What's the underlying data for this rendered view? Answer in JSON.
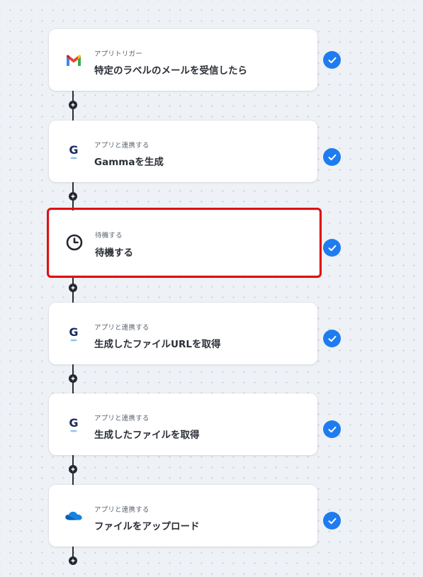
{
  "steps": [
    {
      "kind": "アプリトリガー",
      "title": "特定のラベルのメールを受信したら",
      "icon": "gmail-icon",
      "status": "complete"
    },
    {
      "kind": "アプリと連携する",
      "title": "Gammaを生成",
      "icon": "gamma-icon",
      "status": "complete"
    },
    {
      "kind": "待機する",
      "title": "待機する",
      "icon": "clock-icon",
      "status": "complete",
      "selected": true
    },
    {
      "kind": "アプリと連携する",
      "title": "生成したファイルURLを取得",
      "icon": "gamma-icon",
      "status": "complete"
    },
    {
      "kind": "アプリと連携する",
      "title": "生成したファイルを取得",
      "icon": "gamma-icon",
      "status": "complete"
    },
    {
      "kind": "アプリと連携する",
      "title": "ファイルをアップロード",
      "icon": "onedrive-icon",
      "status": "complete"
    }
  ],
  "colors": {
    "check": "#1f7cf0",
    "selected_outline": "#e01111",
    "connector": "#2b2f36",
    "gmail_red": "#ea4335",
    "gamma_navy": "#1d2a5c",
    "onedrive_blue": "#0f6cbd"
  }
}
